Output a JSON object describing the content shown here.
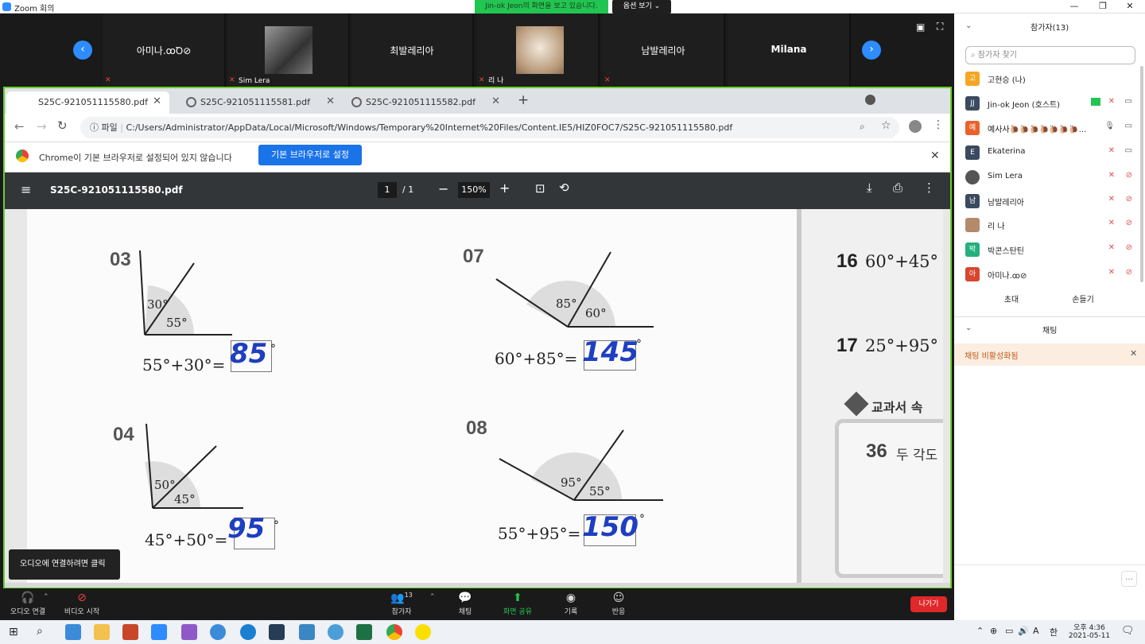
{
  "window": {
    "title": "Zoom 회의",
    "share_banner": "Jin-ok Jeon의 화면을 보고 있습니다.",
    "view_options": "옵션 보기 ⌄"
  },
  "video_tiles": [
    {
      "name": "아미나.ꝏꝹ⊘",
      "caption": ""
    },
    {
      "name": "",
      "caption": "Sim Lera"
    },
    {
      "name": "최발레리아",
      "caption": ""
    },
    {
      "name": "",
      "caption": "리 나"
    },
    {
      "name": "남발레리아",
      "caption": ""
    },
    {
      "name": "Milana",
      "caption": ""
    }
  ],
  "browser": {
    "tabs": [
      {
        "label": "S25C-921051115580.pdf"
      },
      {
        "label": "S25C-921051115581.pdf"
      },
      {
        "label": "S25C-921051115582.pdf"
      }
    ],
    "url_prefix": "파일",
    "url": "C:/Users/Administrator/AppData/Local/Microsoft/Windows/Temporary%20Internet%20Files/Content.IE5/HIZ0FOC7/S25C-921051115580.pdf",
    "infobar_text": "Chrome이 기본 브라우저로 설정되어 있지 않습니다",
    "infobar_button": "기본 브라우저로 설정"
  },
  "pdf": {
    "filename": "S25C-921051115580.pdf",
    "page_current": "1",
    "page_total": "/  1",
    "zoom": "150%",
    "problems": [
      {
        "num": "03",
        "a1": "30°",
        "a2": "55°",
        "eq": "55°+30°=",
        "answer": "85",
        "deg": "°"
      },
      {
        "num": "07",
        "a1": "85°",
        "a2": "60°",
        "eq": "60°+85°=",
        "answer": "145",
        "deg": "°"
      },
      {
        "num": "04",
        "a1": "50°",
        "a2": "45°",
        "eq": "45°+50°=",
        "answer": "95",
        "deg": "°"
      },
      {
        "num": "08",
        "a1": "95°",
        "a2": "55°",
        "eq": "55°+95°=",
        "answer": "150",
        "deg": "°"
      }
    ],
    "side": [
      {
        "num": "16",
        "expr": "60°+45°"
      },
      {
        "num": "17",
        "expr": "25°+95°"
      }
    ],
    "side_heading": "교과서 속",
    "side_q_num": "36",
    "side_q_text": "두 각도"
  },
  "tooltip": "오디오에 연결하려면 클릭",
  "toolbar": {
    "audio": "오디오 연결",
    "video": "비디오 시작",
    "participants": "참가자",
    "participants_count": "13",
    "chat": "채팅",
    "share": "화면 공유",
    "record": "기록",
    "reactions": "반응",
    "leave": "나가기"
  },
  "panel": {
    "participants_header": "참가자(13)",
    "search_placeholder": "참가자 찾기",
    "participants": [
      {
        "initial": "고",
        "color": "#f5a623",
        "name": "고현승 (나)"
      },
      {
        "initial": "JJ",
        "color": "#3b4a5e",
        "name": "Jin-ok Jeon (호스트)"
      },
      {
        "initial": "예",
        "color": "#e8632b",
        "name": "예사사🐌🐌🐌🐌🐌🐌🐌..."
      },
      {
        "initial": "E",
        "color": "#3b4a5e",
        "name": "Ekaterina"
      },
      {
        "initial": "",
        "color": "#555555",
        "name": "Sim Lera"
      },
      {
        "initial": "남",
        "color": "#3b4a5e",
        "name": "남발레리아"
      },
      {
        "initial": "",
        "color": "#b58a6a",
        "name": "리 나"
      },
      {
        "initial": "박",
        "color": "#23b07d",
        "name": "박콘스탄틴"
      },
      {
        "initial": "아",
        "color": "#d8462f",
        "name": "아미나.ꝏ⊘"
      }
    ],
    "invite": "초대",
    "raise_hand": "손들기",
    "chat_header": "채팅",
    "chat_disabled": "채팅 비활성화됨"
  },
  "taskbar": {
    "time": "오후 4:36",
    "date": "2021-05-11",
    "ime": "A",
    "lang": "한"
  }
}
